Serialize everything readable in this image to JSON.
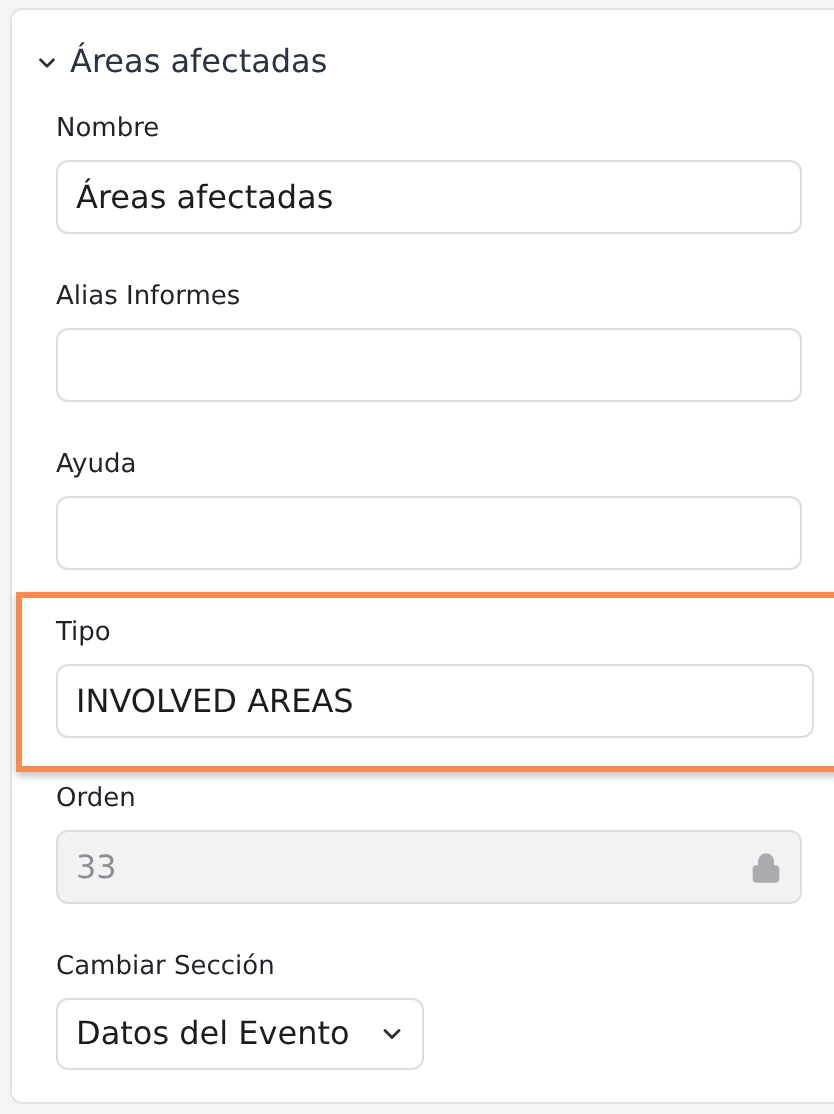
{
  "section": {
    "title": "Áreas afectadas",
    "expanded": true
  },
  "fields": [
    {
      "kind": "text",
      "label": "Nombre",
      "value": "Áreas afectadas",
      "highlighted": false
    },
    {
      "kind": "text",
      "label": "Alias Informes",
      "highlighted": false
    },
    {
      "kind": "text",
      "label": "Ayuda",
      "highlighted": false
    },
    {
      "kind": "text",
      "label": "Tipo",
      "value": "INVOLVED AREAS",
      "highlighted": true
    },
    {
      "kind": "locked",
      "label": "Orden",
      "value": "33",
      "highlighted": false
    },
    {
      "kind": "select",
      "label": "Cambiar Sección",
      "value": "Datos del Evento",
      "highlighted": false
    }
  ]
}
